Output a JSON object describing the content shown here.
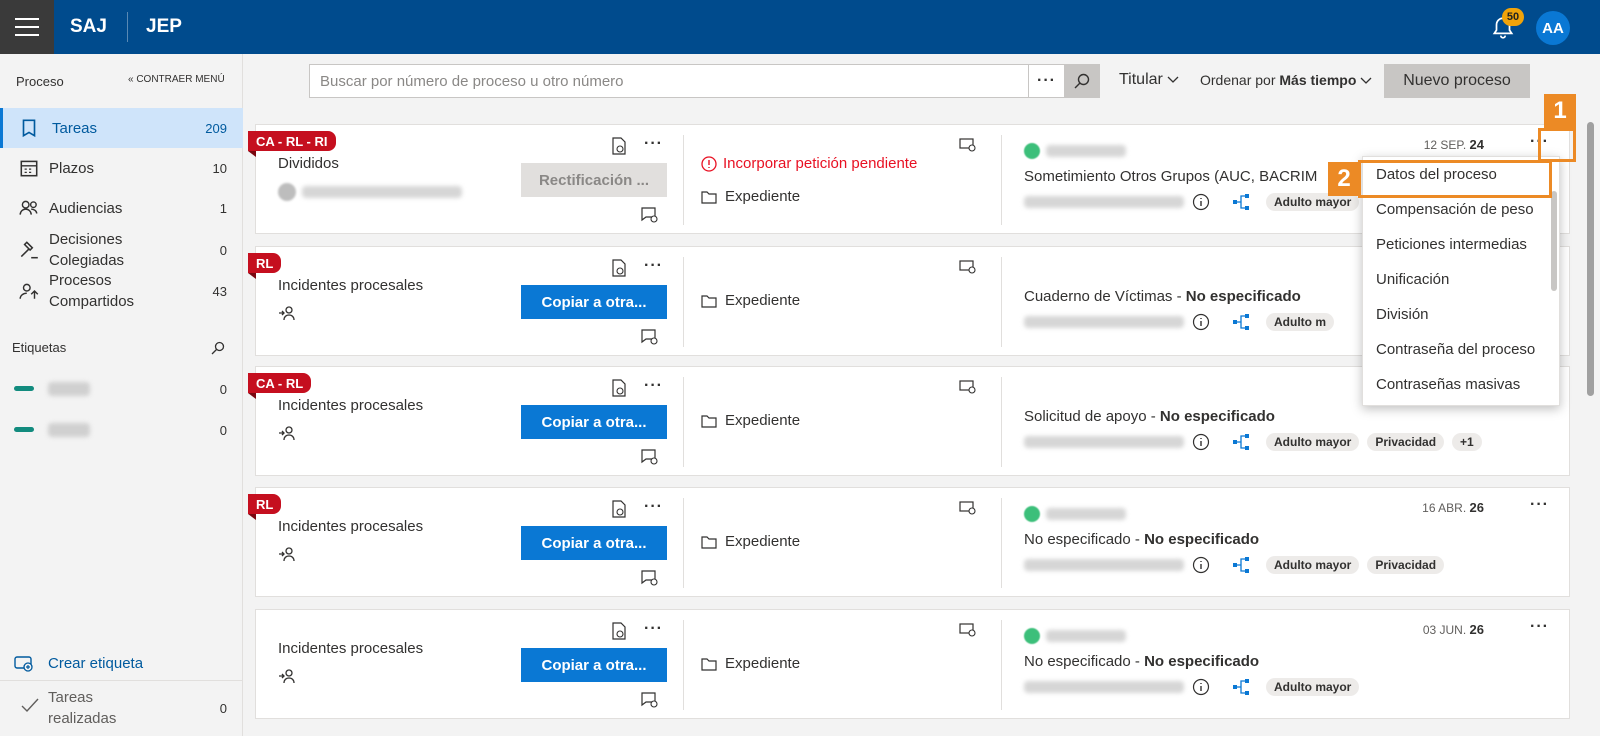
{
  "header": {
    "brand": "SAJ",
    "app": "JEP",
    "notifications": "50",
    "avatar": "AA"
  },
  "sidebar": {
    "title": "Proceso",
    "collapse": "« CONTRAER MENÚ",
    "items": [
      {
        "label": "Tareas",
        "count": "209",
        "icon": "book-icon"
      },
      {
        "label": "Plazos",
        "count": "10",
        "icon": "calendar-icon"
      },
      {
        "label": "Audiencias",
        "count": "1",
        "icon": "people-icon"
      },
      {
        "label": "Decisiones Colegiadas",
        "count": "0",
        "icon": "gavel-icon"
      },
      {
        "label": "Procesos Compartidos",
        "count": "43",
        "icon": "shared-icon"
      }
    ],
    "labels_title": "Etiquetas",
    "tags": [
      {
        "count": "0"
      },
      {
        "count": "0"
      }
    ],
    "create_tag": "Crear etiqueta",
    "done": {
      "label": "Tareas realizadas",
      "count": "0"
    }
  },
  "toolbar": {
    "search_placeholder": "Buscar por número de proceso u otro número",
    "titular": "Titular",
    "order_prefix": "Ordenar por",
    "order_value": "Más tiempo",
    "new_button": "Nuevo proceso"
  },
  "cards": [
    {
      "flag": "CA - RL - RI",
      "title": "Divididos",
      "action": "Rectificación ...",
      "alert": "Incorporar petición pendiente",
      "expediente": "Expediente",
      "desc": "Sometimiento Otros Grupos (AUC, BACRIM",
      "desc_bold": "",
      "chips": [
        "Adulto mayor"
      ],
      "date_prefix": "12 SEP.",
      "date_day": "24"
    },
    {
      "flag": "RL",
      "title": "Incidentes procesales",
      "action": "Copiar a otra...",
      "alert": "",
      "expediente": "Expediente",
      "desc": "Cuaderno de Víctimas - ",
      "desc_bold": "No especificado",
      "chips": [
        "Adulto m"
      ],
      "date_prefix": "",
      "date_day": ""
    },
    {
      "flag": "CA - RL",
      "title": "Incidentes procesales",
      "action": "Copiar a otra...",
      "alert": "",
      "expediente": "Expediente",
      "desc": "Solicitud de apoyo - ",
      "desc_bold": "No especificado",
      "chips": [
        "Adulto mayor",
        "Privacidad",
        "+1"
      ],
      "date_prefix": "",
      "date_day": ""
    },
    {
      "flag": "RL",
      "title": "Incidentes procesales",
      "action": "Copiar a otra...",
      "alert": "",
      "expediente": "Expediente",
      "desc": "No especificado - ",
      "desc_bold": "No especificado",
      "chips": [
        "Adulto mayor",
        "Privacidad"
      ],
      "date_prefix": "16 ABR.",
      "date_day": "26"
    },
    {
      "flag": "",
      "title": "Incidentes procesales",
      "action": "Copiar a otra...",
      "alert": "",
      "expediente": "Expediente",
      "desc": "No especificado - ",
      "desc_bold": "No especificado",
      "chips": [
        "Adulto mayor"
      ],
      "date_prefix": "03 JUN.",
      "date_day": "26"
    }
  ],
  "menu": {
    "items": [
      "Datos del proceso",
      "Compensación de peso",
      "Peticiones intermedias",
      "Unificación",
      "División",
      "Contraseña del proceso",
      "Contraseñas masivas"
    ]
  },
  "callouts": [
    "1",
    "2"
  ],
  "colors": {
    "header": "#004b8d",
    "primary": "#0a78d4",
    "flag": "#c50f1f",
    "callout": "#ec8a25"
  }
}
